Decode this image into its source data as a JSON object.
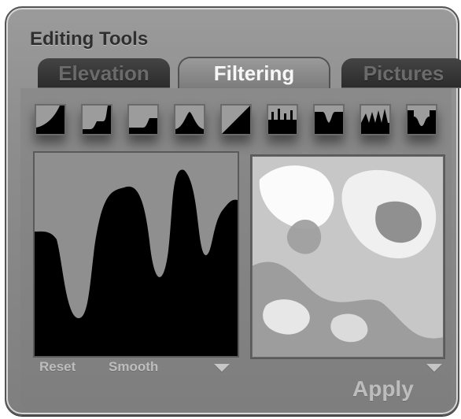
{
  "panel": {
    "title": "Editing Tools"
  },
  "tabs": [
    {
      "label": "Elevation"
    },
    {
      "label": "Filtering"
    },
    {
      "label": "Pictures"
    }
  ],
  "toolbar": {
    "icons": [
      "curve-up-icon",
      "stairs-curve-icon",
      "step-curve-icon",
      "peak-curve-icon",
      "linear-ramp-icon",
      "comb-spikes-icon",
      "notch-curve-icon",
      "sawtooth-spikes-icon",
      "dip-curve-icon"
    ]
  },
  "controls": {
    "reset_label": "Reset",
    "smooth_label": "Smooth",
    "apply_label": "Apply"
  }
}
